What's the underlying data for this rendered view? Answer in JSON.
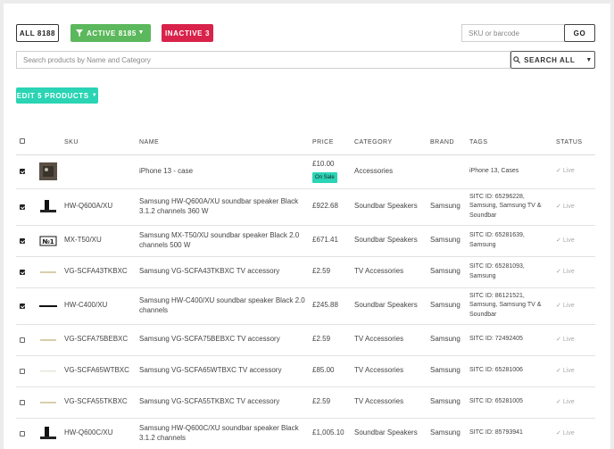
{
  "filters": {
    "all_label": "ALL 8188",
    "active_label": "ACTIVE 8185",
    "inactive_label": "INACTIVE 3",
    "sku_placeholder": "SKU or barcode",
    "go_label": "GO",
    "search_placeholder": "Search products by Name and Category",
    "search_all_label": "SEARCH ALL",
    "edit_label": "EDIT 5 PRODUCTS"
  },
  "table": {
    "headers": {
      "sku": "SKU",
      "name": "NAME",
      "price": "PRICE",
      "category": "CATEGORY",
      "brand": "BRAND",
      "tags": "TAGS",
      "status": "STATUS"
    },
    "on_sale_label": "On Sale",
    "rows": [
      {
        "checked": true,
        "thumb": "phone-case",
        "sku": "",
        "name": "iPhone 13 - case",
        "price": "£10.00",
        "on_sale": true,
        "category": "Accessories",
        "brand": "",
        "tags": "iPhone 13, Cases",
        "status": "Live"
      },
      {
        "checked": true,
        "thumb": "soundbar-stand",
        "sku": "HW-Q600A/XU",
        "name": "Samsung HW-Q600A/XU soundbar speaker Black 3.1.2 channels 360 W",
        "price": "£922.68",
        "on_sale": false,
        "category": "Soundbar Speakers",
        "brand": "Samsung",
        "tags": "SITC ID: 65296228, Samsung, Samsung TV & Soundbar",
        "status": "Live"
      },
      {
        "checked": true,
        "thumb": "no1-label",
        "sku": "MX-T50/XU",
        "name": "Samsung MX-T50/XU soundbar speaker Black 2.0 channels 500 W",
        "price": "£671.41",
        "on_sale": false,
        "category": "Soundbar Speakers",
        "brand": "Samsung",
        "tags": "SITC ID: 65281639, Samsung",
        "status": "Live"
      },
      {
        "checked": true,
        "thumb": "thin-bar",
        "sku": "VG-SCFA43TKBXC",
        "name": "Samsung VG-SCFA43TKBXC TV accessory",
        "price": "£2.59",
        "on_sale": false,
        "category": "TV Accessories",
        "brand": "Samsung",
        "tags": "SITC ID: 65281093, Samsung",
        "status": "Live"
      },
      {
        "checked": true,
        "thumb": "black-bar",
        "sku": "HW-C400/XU",
        "name": "Samsung HW-C400/XU soundbar speaker Black 2.0 channels",
        "price": "£245.88",
        "on_sale": false,
        "category": "Soundbar Speakers",
        "brand": "Samsung",
        "tags": "SITC ID: 86121521, Samsung, Samsung TV & Soundbar",
        "status": "Live"
      },
      {
        "checked": false,
        "thumb": "thin-bar",
        "sku": "VG-SCFA75BEBXC",
        "name": "Samsung VG-SCFA75BEBXC TV accessory",
        "price": "£2.59",
        "on_sale": false,
        "category": "TV Accessories",
        "brand": "Samsung",
        "tags": "SITC ID: 72492405",
        "status": "Live"
      },
      {
        "checked": false,
        "thumb": "thin-bar-light",
        "sku": "VG-SCFA65WTBXC",
        "name": "Samsung VG-SCFA65WTBXC TV accessory",
        "price": "£85.00",
        "on_sale": false,
        "category": "TV Accessories",
        "brand": "Samsung",
        "tags": "SITC ID: 65281006",
        "status": "Live"
      },
      {
        "checked": false,
        "thumb": "thin-bar",
        "sku": "VG-SCFA55TKBXC",
        "name": "Samsung VG-SCFA55TKBXC TV accessory",
        "price": "£2.59",
        "on_sale": false,
        "category": "TV Accessories",
        "brand": "Samsung",
        "tags": "SITC ID: 65281005",
        "status": "Live"
      },
      {
        "checked": false,
        "thumb": "soundbar-stand",
        "sku": "HW-Q600C/XU",
        "name": "Samsung HW-Q600C/XU soundbar speaker Black 3.1.2 channels",
        "price": "£1,005.10",
        "on_sale": false,
        "category": "Soundbar Speakers",
        "brand": "Samsung",
        "tags": "SITC ID: 85793941",
        "status": "Live"
      }
    ]
  },
  "colors": {
    "active": "#5cb85c",
    "inactive": "#d9224a",
    "accent": "#2ad4b4"
  }
}
